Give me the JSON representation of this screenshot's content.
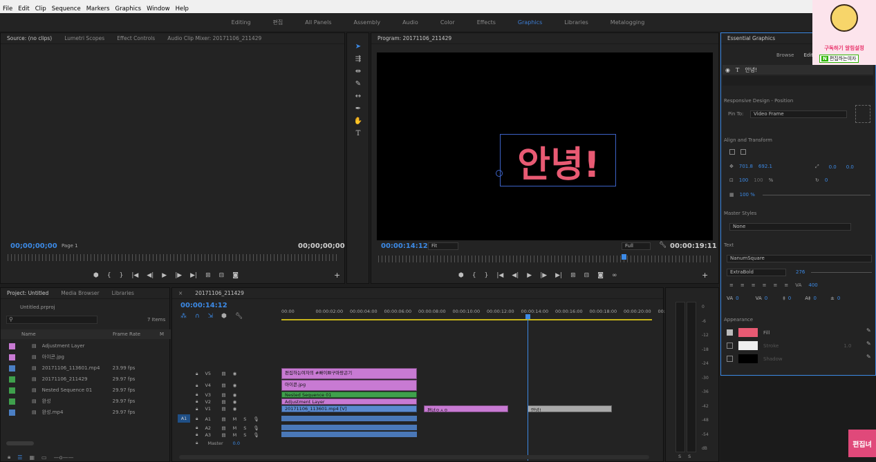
{
  "menu": [
    "File",
    "Edit",
    "Clip",
    "Sequence",
    "Markers",
    "Graphics",
    "Window",
    "Help"
  ],
  "workspaces": {
    "tabs": [
      "Editing",
      "편집",
      "All Panels",
      "Assembly",
      "Audio",
      "Color",
      "Effects",
      "Graphics",
      "Libraries",
      "Metalogging"
    ],
    "active": "Graphics"
  },
  "source": {
    "tabs": [
      "Source: (no clips)",
      "Lumetri Scopes",
      "Effect Controls",
      "Audio Clip Mixer: 20171106_211429"
    ],
    "tc_left": "00;00;00;00",
    "page": "Page 1",
    "tc_right": "00;00;00;00"
  },
  "program": {
    "tab": "Program: 20171106_211429",
    "overlay_text": "안녕!",
    "tc_left": "00:00:14:12",
    "fit": "Fit",
    "quality": "Full",
    "tc_right": "00:00:19:11"
  },
  "project": {
    "tabs": [
      "Project: Untitled",
      "Media Browser",
      "Libraries"
    ],
    "file": "Untitled.prproj",
    "items_count": "7 Items",
    "columns": [
      "Name",
      "Frame Rate",
      "M"
    ],
    "items": [
      {
        "name": "Adjustment Layer",
        "fps": "",
        "color": "#c87ad3"
      },
      {
        "name": "아이콘.jpg",
        "fps": "",
        "color": "#c87ad3"
      },
      {
        "name": "20171106_113601.mp4",
        "fps": "23.99 fps",
        "color": "#4b7fc4"
      },
      {
        "name": "20171106_211429",
        "fps": "29.97 fps",
        "color": "#3fa04c"
      },
      {
        "name": "Nested Sequence 01",
        "fps": "29.97 fps",
        "color": "#3fa04c"
      },
      {
        "name": "완성",
        "fps": "29.97 fps",
        "color": "#3fa04c"
      },
      {
        "name": "완성.mp4",
        "fps": "29.97 fps",
        "color": "#4b7fc4"
      }
    ]
  },
  "timeline": {
    "tab": "20171106_211429",
    "tc": "00:00:14:12",
    "ruler": [
      "00:00",
      "00:00:02:00",
      "00:00:04:00",
      "00:00:06:00",
      "00:00:08:00",
      "00:00:10:00",
      "00:00:12:00",
      "00:00:14:00",
      "00:00:16:00",
      "00:00:18:00",
      "00:00:20:00",
      "00:"
    ],
    "video_tracks": [
      "V5",
      "V4",
      "V3",
      "V2",
      "V1"
    ],
    "audio_tracks": [
      "A1",
      "A2",
      "A3"
    ],
    "master": "Master",
    "master_val": "0.0",
    "clips": {
      "v5": "편집하는여자의 #빠이쁘구마팡곤기",
      "v4": "아이콘.jpg",
      "v3": "Nested Sequence 01",
      "v2": "Adjustment Layer",
      "v1": "20171106_113601.mp4 [V]",
      "v1b": "편녀ㅇㅅㅇ",
      "v1c": "안녕!"
    }
  },
  "meter": {
    "labels": [
      "0",
      "-6",
      "-12",
      "-18",
      "-24",
      "-30",
      "-36",
      "-42",
      "-48",
      "-54",
      "dB"
    ],
    "solo": [
      "S",
      "S"
    ]
  },
  "eg": {
    "title": "Essential Graphics",
    "tabs": [
      "Browse",
      "Edit"
    ],
    "layer": "안녕!",
    "responsive": "Responsive Design - Position",
    "pin_label": "Pin To:",
    "pin_value": "Video Frame",
    "align_title": "Align and Transform",
    "pos_x": "701.8",
    "pos_y": "692.1",
    "anchor_x": "0.0",
    "anchor_y": "0.0",
    "scale": "100",
    "scale2": "100",
    "pct": "%",
    "rotation": "0",
    "opacity": "100 %",
    "master_styles": "Master Styles",
    "ms_value": "None",
    "text_title": "Text",
    "font": "NanumSquare",
    "weight": "ExtraBold",
    "size": "276",
    "tracking": "400",
    "t_vals": [
      "0",
      "0",
      "0",
      "0",
      "0"
    ],
    "appearance": "Appearance",
    "fill": "Fill",
    "stroke": "Stroke",
    "stroke_val": "1.0",
    "shadow": "Shadow",
    "fill_color": "#e85a73"
  },
  "avatar": {
    "title": "구독하기 알림설정",
    "badge": "편집하는여자",
    "corner": "편집녀"
  }
}
